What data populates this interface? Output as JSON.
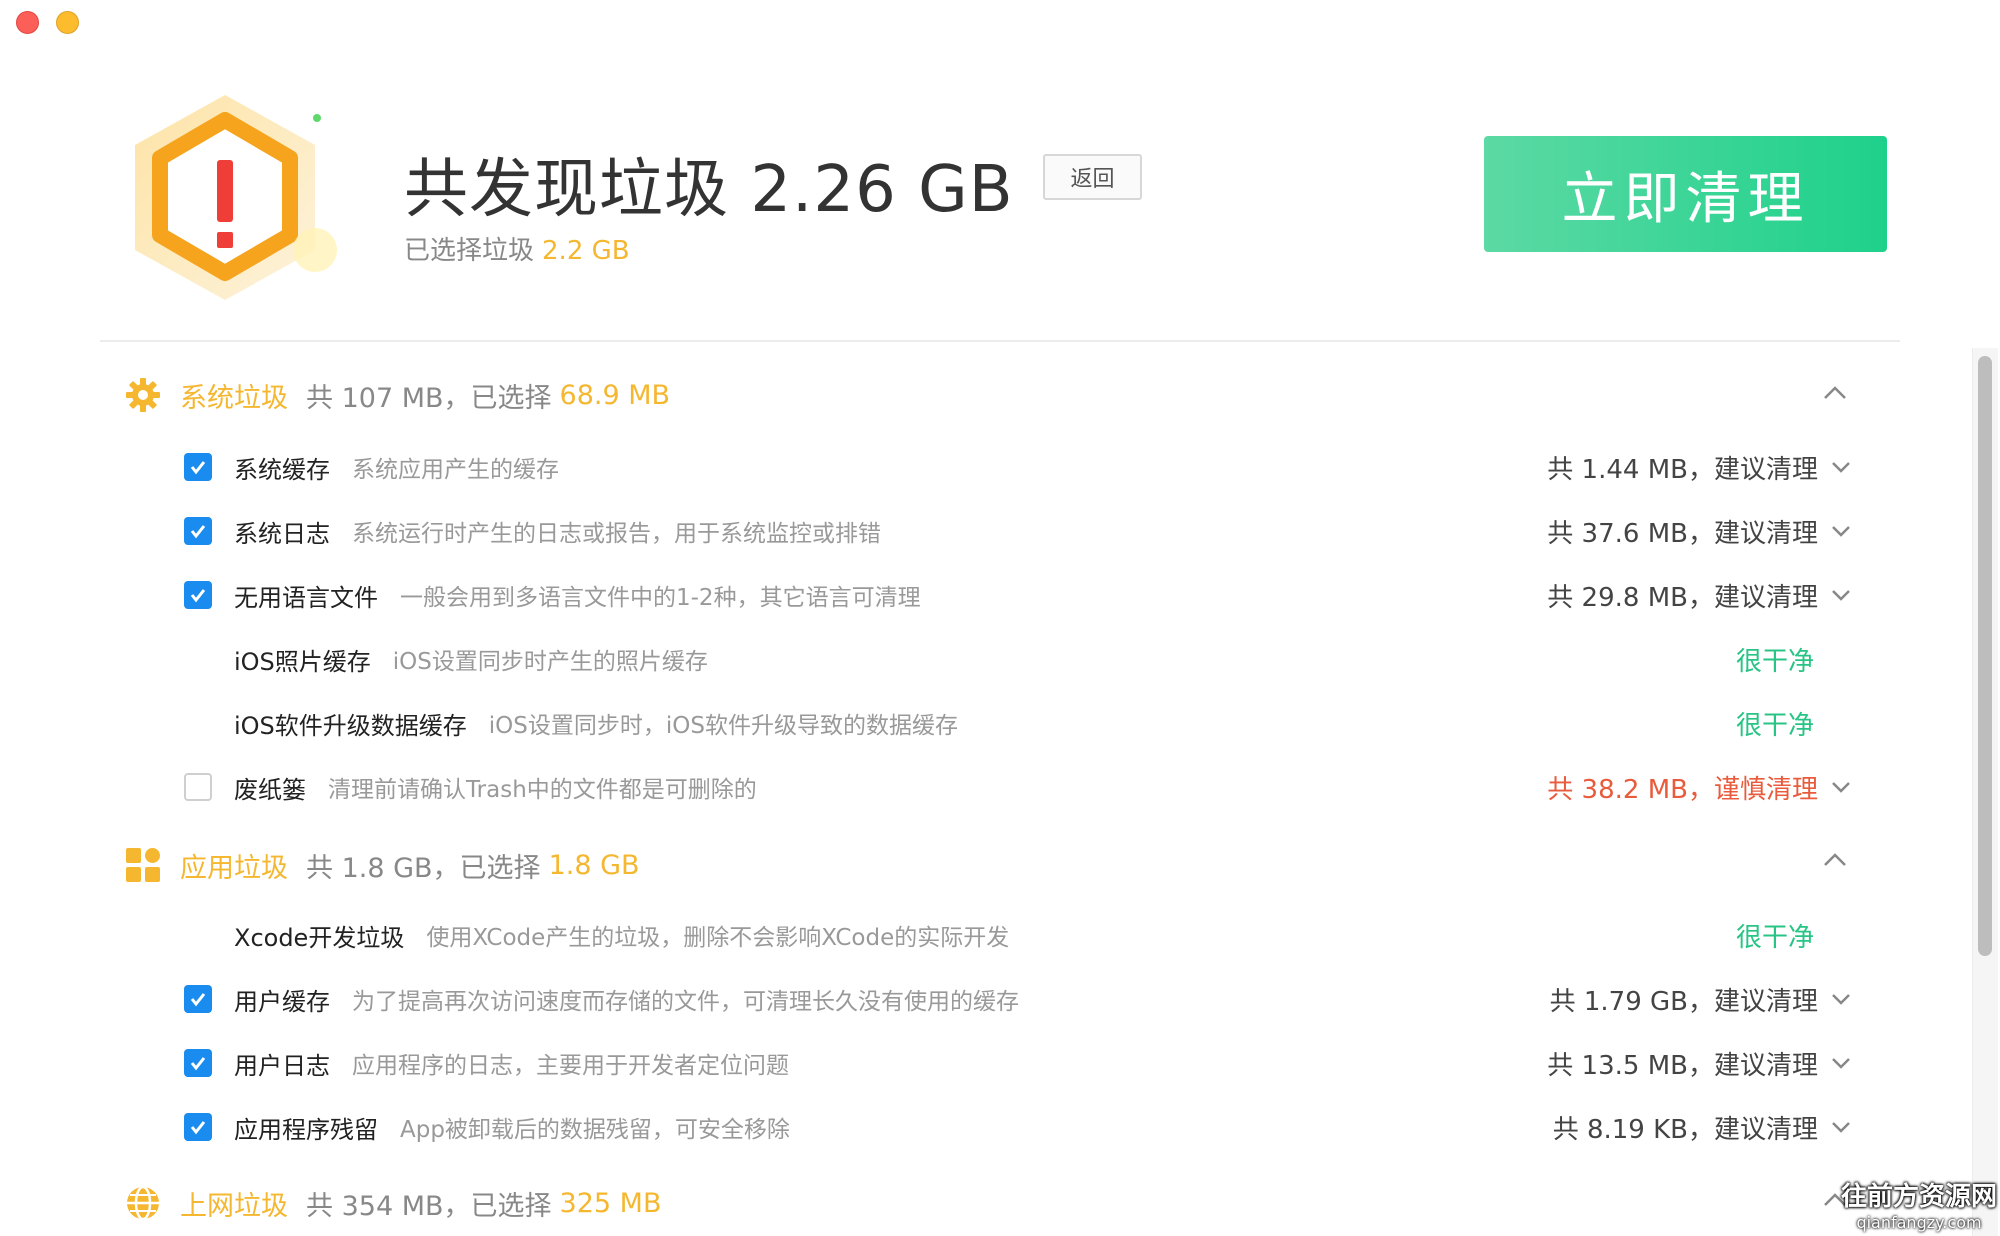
{
  "header": {
    "title": "共发现垃圾 2.26 GB",
    "subtitle_label": "已选择垃圾",
    "subtitle_value": "2.2 GB",
    "back_label": "返回",
    "clean_label": "立即清理"
  },
  "colors": {
    "accent_orange": "#f5b730",
    "accent_green": "#1ed18b",
    "checkbox_blue": "#1a8cf0",
    "warn_red": "#e85b3c"
  },
  "sections": [
    {
      "icon": "gear-icon",
      "title": "系统垃圾",
      "summary": "共 107 MB，已选择",
      "selected": "68.9 MB",
      "items": [
        {
          "checked": true,
          "name": "系统缓存",
          "desc": "系统应用产生的缓存",
          "status": "共 1.44 MB，建议清理"
        },
        {
          "checked": true,
          "name": "系统日志",
          "desc": "系统运行时产生的日志或报告，用于系统监控或排错",
          "status": "共 37.6 MB，建议清理"
        },
        {
          "checked": true,
          "name": "无用语言文件",
          "desc": "一般会用到多语言文件中的1-2种，其它语言可清理",
          "status": "共 29.8 MB，建议清理"
        },
        {
          "checked": null,
          "name": "iOS照片缓存",
          "desc": "iOS设置同步时产生的照片缓存",
          "status": "很干净"
        },
        {
          "checked": null,
          "name": "iOS软件升级数据缓存",
          "desc": "iOS设置同步时，iOS软件升级导致的数据缓存",
          "status": "很干净"
        },
        {
          "checked": false,
          "name": "废纸篓",
          "desc": "清理前请确认Trash中的文件都是可删除的",
          "status": "共 38.2 MB，谨慎清理"
        }
      ]
    },
    {
      "icon": "apps-grid-icon",
      "title": "应用垃圾",
      "summary": "共 1.8 GB，已选择",
      "selected": "1.8 GB",
      "items": [
        {
          "checked": null,
          "name": "Xcode开发垃圾",
          "desc": "使用XCode产生的垃圾，删除不会影响XCode的实际开发",
          "status": "很干净"
        },
        {
          "checked": true,
          "name": "用户缓存",
          "desc": "为了提高再次访问速度而存储的文件，可清理长久没有使用的缓存",
          "status": "共 1.79 GB，建议清理"
        },
        {
          "checked": true,
          "name": "用户日志",
          "desc": "应用程序的日志，主要用于开发者定位问题",
          "status": "共 13.5 MB，建议清理"
        },
        {
          "checked": true,
          "name": "应用程序残留",
          "desc": "App被卸载后的数据残留，可安全移除",
          "status": "共 8.19 KB，建议清理"
        }
      ]
    },
    {
      "icon": "globe-icon",
      "title": "上网垃圾",
      "summary": "共 354 MB，已选择",
      "selected": "325 MB",
      "items": []
    }
  ],
  "watermark": {
    "line1": "往前方资源网",
    "line2": "qianfangzy.com"
  }
}
